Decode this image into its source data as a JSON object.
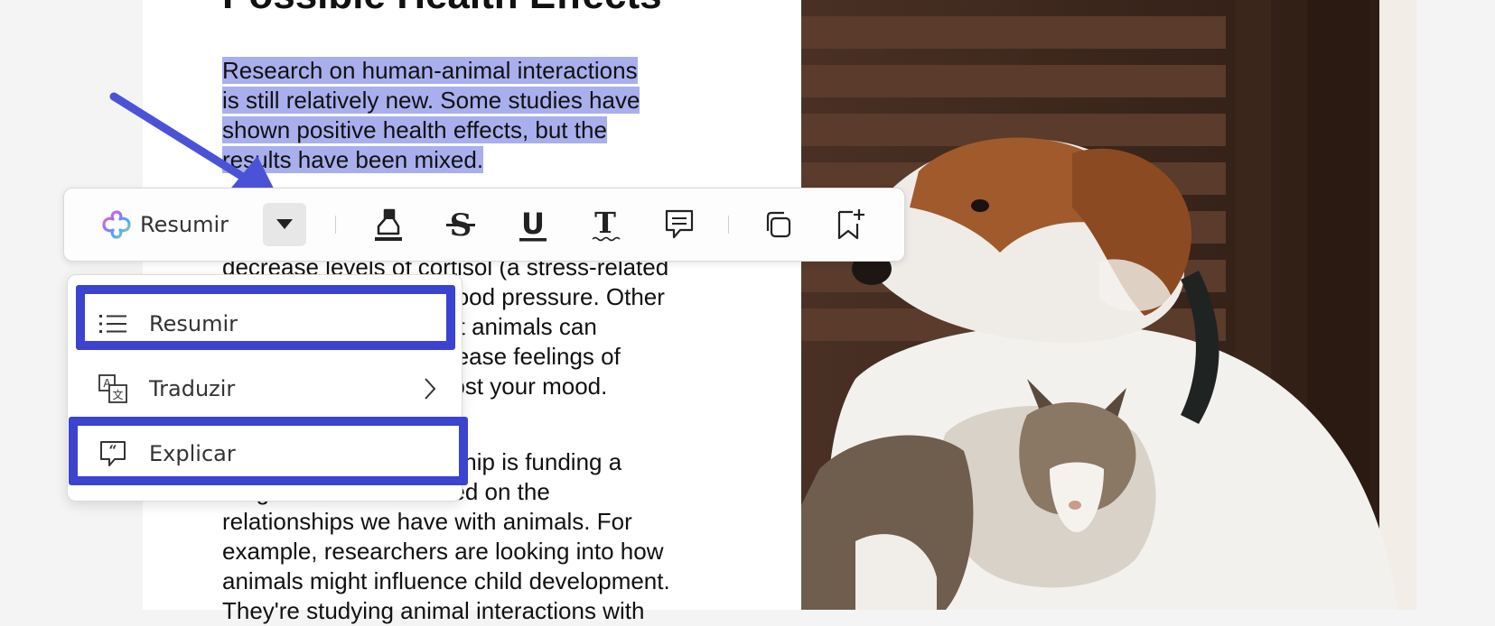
{
  "article": {
    "heading": "Possible Health Effects",
    "para1_lines": [
      "Research on human-animal interactions",
      "is still relatively new. Some studies have",
      "shown positive health effects, but the",
      "results have been mixed."
    ],
    "para2_lines": [
      "decrease levels of cortisol (a stress-related",
      "hormone) and lower blood pressure. Other",
      "studies have found that animals can",
      "reduce loneliness, increase feelings of",
      "social support, and boost your mood."
    ],
    "para3_lines": [
      "The NIH/Mars Partnership is funding a",
      "range of studies focused on the",
      "relationships we have with animals. For",
      "example, researchers are looking into how",
      "animals might influence child development.",
      "They're studying animal interactions with"
    ]
  },
  "toolbar": {
    "ai_label": "Resumir",
    "tools": [
      "highlight-icon",
      "strikethrough-icon",
      "underline-icon",
      "text-icon",
      "comment-icon",
      "copy-icon",
      "bookmark-add-icon"
    ]
  },
  "menu": {
    "items": [
      {
        "label": "Resumir",
        "icon": "list-icon"
      },
      {
        "label": "Traduzir",
        "icon": "translate-icon"
      },
      {
        "label": "Explicar",
        "icon": "explain-icon"
      }
    ]
  },
  "colors": {
    "selection": "#a9afed",
    "annotation_blue": "#3b43d0",
    "arrow_blue": "#4a53d8"
  }
}
